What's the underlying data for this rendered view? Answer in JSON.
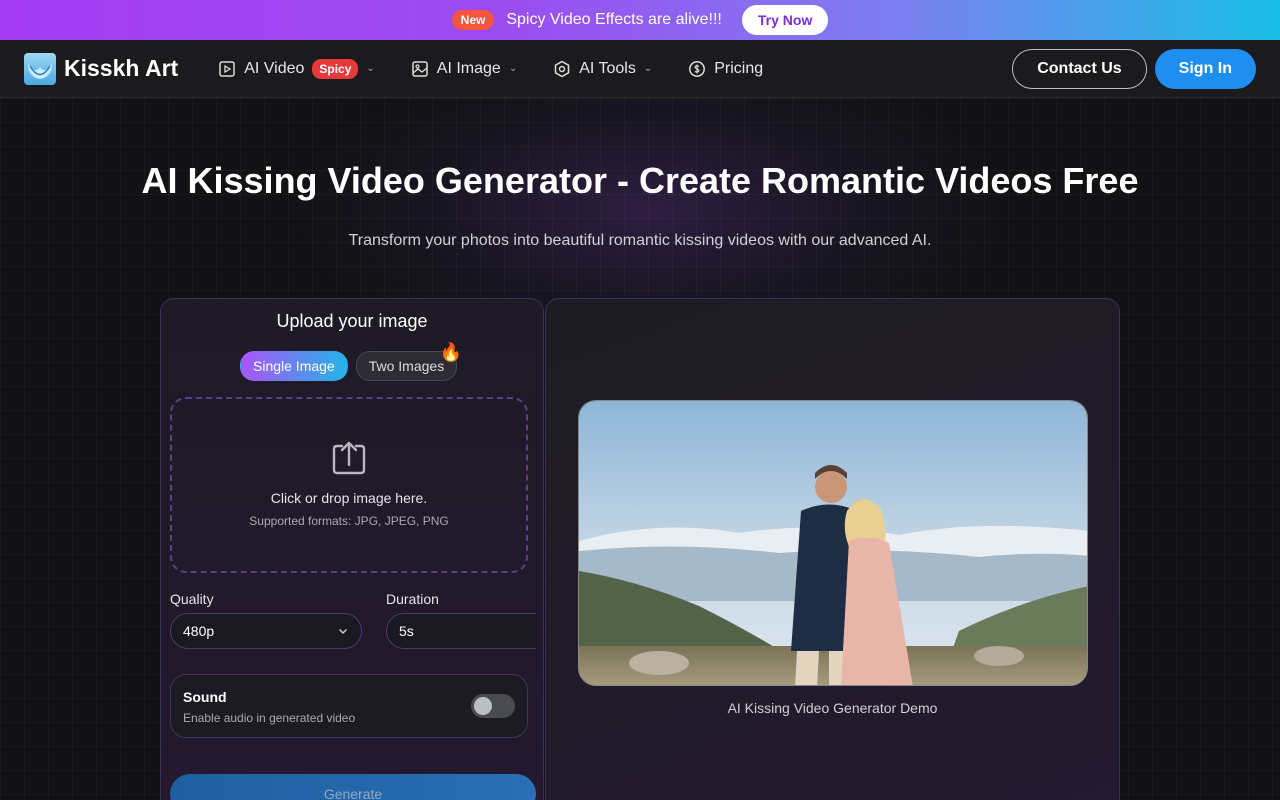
{
  "promo": {
    "badge": "New",
    "text": "Spicy Video Effects are alive!!!",
    "cta": "Try Now"
  },
  "header": {
    "brand": "Kisskh Art",
    "nav": [
      {
        "label": "AI Video",
        "badge": "Spicy"
      },
      {
        "label": "AI Image"
      },
      {
        "label": "AI Tools"
      },
      {
        "label": "Pricing"
      }
    ],
    "contact_label": "Contact Us",
    "signin_label": "Sign In"
  },
  "hero": {
    "title": "AI Kissing Video Generator - Create Romantic Videos Free",
    "subtitle": "Transform your photos into beautiful romantic kissing videos with our advanced AI."
  },
  "upload": {
    "title": "Upload your image",
    "modes": [
      "Single Image",
      "Two Images"
    ],
    "active_mode": "Single Image",
    "drop_text": "Click or drop image here.",
    "formats": "Supported formats: JPG, JPEG, PNG",
    "quality_label": "Quality",
    "quality_value": "480p",
    "duration_label": "Duration",
    "duration_value": "5s",
    "sound_title": "Sound",
    "sound_desc": "Enable audio in generated video",
    "sound_enabled": false,
    "generate_label": "Generate"
  },
  "demo": {
    "caption": "AI Kissing Video Generator Demo"
  },
  "colors": {
    "accent": "#1e8ff0",
    "promo_start": "#a43cf2",
    "promo_end": "#18bfe6",
    "spicy": "#e5393b"
  }
}
